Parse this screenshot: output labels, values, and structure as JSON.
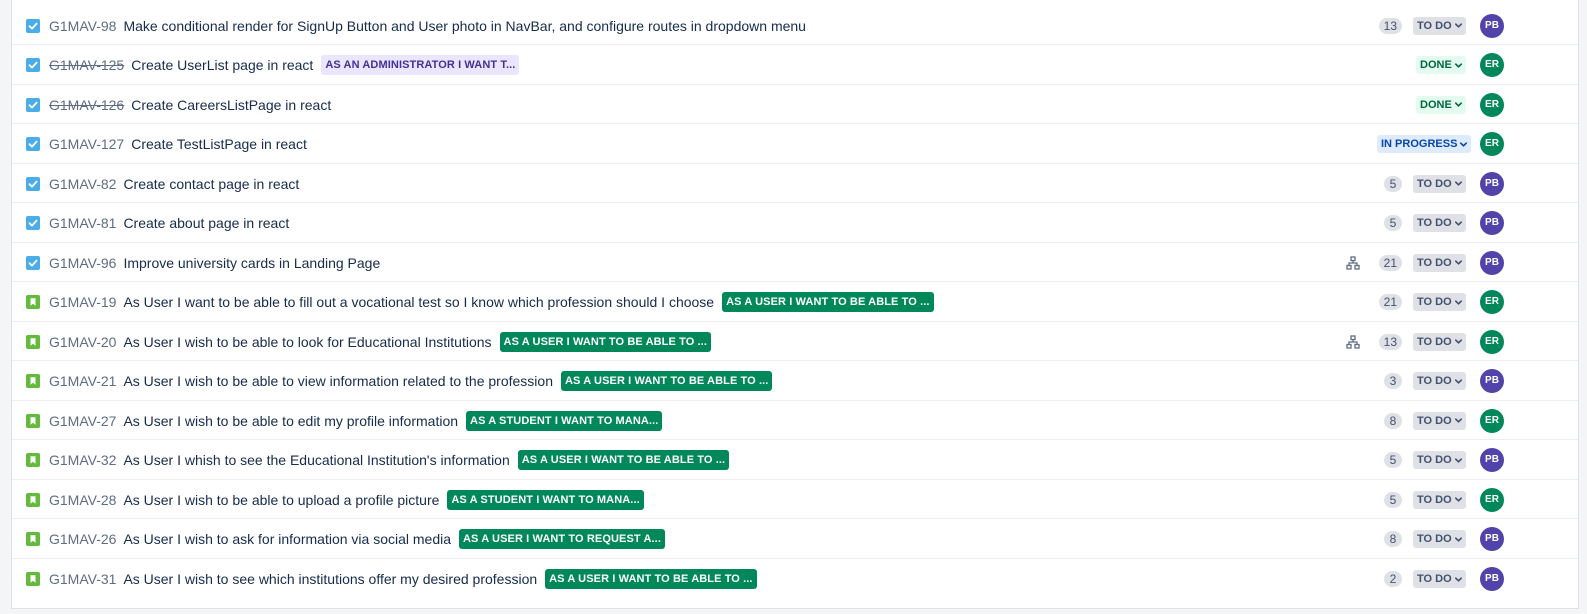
{
  "colors": {
    "task_icon": "#4bade8",
    "story_icon": "#63ba3c",
    "epic_green": "#00875a",
    "epic_purple_bg": "#eae6ff",
    "epic_purple_text": "#403294",
    "avatar_pb": "#5243aa",
    "avatar_er": "#00875a"
  },
  "issues": [
    {
      "type": "task-icon",
      "key": "G1MAV-98",
      "done": false,
      "summary": "Make conditional render for SignUp Button and User photo in NavBar, and configure routes in dropdown menu",
      "epic": "",
      "epic_style": "",
      "child_issues": false,
      "points": "13",
      "status": "TO DO",
      "status_style": "todo",
      "assignee": "PB"
    },
    {
      "type": "task-icon",
      "key": "G1MAV-125",
      "done": true,
      "summary": "Create UserList page in react",
      "epic": "AS AN ADMINISTRATOR I WANT T...",
      "epic_style": "purple",
      "child_issues": false,
      "points": "",
      "status": "DONE",
      "status_style": "done",
      "assignee": "ER"
    },
    {
      "type": "task-icon",
      "key": "G1MAV-126",
      "done": true,
      "summary": "Create CareersListPage in react",
      "epic": "",
      "epic_style": "",
      "child_issues": false,
      "points": "",
      "status": "DONE",
      "status_style": "done",
      "assignee": "ER"
    },
    {
      "type": "task-icon",
      "key": "G1MAV-127",
      "done": false,
      "summary": "Create TestListPage in react",
      "epic": "",
      "epic_style": "",
      "child_issues": false,
      "points": "",
      "status": "IN PROGRESS",
      "status_style": "inprogress",
      "assignee": "ER"
    },
    {
      "type": "task-icon",
      "key": "G1MAV-82",
      "done": false,
      "summary": "Create contact page in react",
      "epic": "",
      "epic_style": "",
      "child_issues": false,
      "points": "5",
      "status": "TO DO",
      "status_style": "todo",
      "assignee": "PB"
    },
    {
      "type": "task-icon",
      "key": "G1MAV-81",
      "done": false,
      "summary": "Create about page in react",
      "epic": "",
      "epic_style": "",
      "child_issues": false,
      "points": "5",
      "status": "TO DO",
      "status_style": "todo",
      "assignee": "PB"
    },
    {
      "type": "task-icon",
      "key": "G1MAV-96",
      "done": false,
      "summary": "Improve university cards in Landing Page",
      "epic": "",
      "epic_style": "",
      "child_issues": true,
      "points": "21",
      "status": "TO DO",
      "status_style": "todo",
      "assignee": "PB"
    },
    {
      "type": "story-icon",
      "key": "G1MAV-19",
      "done": false,
      "summary": "As User I want to be able to fill out a vocational test so I know which profession should I choose",
      "epic": "AS A USER I WANT TO BE ABLE TO ...",
      "epic_style": "green",
      "child_issues": false,
      "points": "21",
      "status": "TO DO",
      "status_style": "todo",
      "assignee": "ER"
    },
    {
      "type": "story-icon",
      "key": "G1MAV-20",
      "done": false,
      "summary": "As User I wish to be able to look for Educational Institutions",
      "epic": "AS A USER I WANT TO BE ABLE TO ...",
      "epic_style": "green",
      "child_issues": true,
      "points": "13",
      "status": "TO DO",
      "status_style": "todo",
      "assignee": "ER"
    },
    {
      "type": "story-icon",
      "key": "G1MAV-21",
      "done": false,
      "summary": "As User I wish to be able to view information related to the profession",
      "epic": "AS A USER I WANT TO BE ABLE TO ...",
      "epic_style": "green",
      "child_issues": false,
      "points": "3",
      "status": "TO DO",
      "status_style": "todo",
      "assignee": "PB"
    },
    {
      "type": "story-icon",
      "key": "G1MAV-27",
      "done": false,
      "summary": "As User I wish to be able to edit my profile information",
      "epic": "AS A STUDENT I WANT TO MANA...",
      "epic_style": "green",
      "child_issues": false,
      "points": "8",
      "status": "TO DO",
      "status_style": "todo",
      "assignee": "ER"
    },
    {
      "type": "story-icon",
      "key": "G1MAV-32",
      "done": false,
      "summary": "As User I whish to see the Educational Institution's information",
      "epic": "AS A USER I WANT TO BE ABLE TO ...",
      "epic_style": "green",
      "child_issues": false,
      "points": "5",
      "status": "TO DO",
      "status_style": "todo",
      "assignee": "PB"
    },
    {
      "type": "story-icon",
      "key": "G1MAV-28",
      "done": false,
      "summary": "As User I wish to be able to upload a profile picture",
      "epic": "AS A STUDENT I WANT TO MANA...",
      "epic_style": "green",
      "child_issues": false,
      "points": "5",
      "status": "TO DO",
      "status_style": "todo",
      "assignee": "ER"
    },
    {
      "type": "story-icon",
      "key": "G1MAV-26",
      "done": false,
      "summary": "As User I wish to ask for information via social media",
      "epic": "AS A USER I WANT TO REQUEST A...",
      "epic_style": "green",
      "child_issues": false,
      "points": "8",
      "status": "TO DO",
      "status_style": "todo",
      "assignee": "PB"
    },
    {
      "type": "story-icon",
      "key": "G1MAV-31",
      "done": false,
      "summary": "As User I wish to see which institutions offer my desired profession",
      "epic": "AS A USER I WANT TO BE ABLE TO ...",
      "epic_style": "green",
      "child_issues": false,
      "points": "2",
      "status": "TO DO",
      "status_style": "todo",
      "assignee": "PB"
    }
  ]
}
